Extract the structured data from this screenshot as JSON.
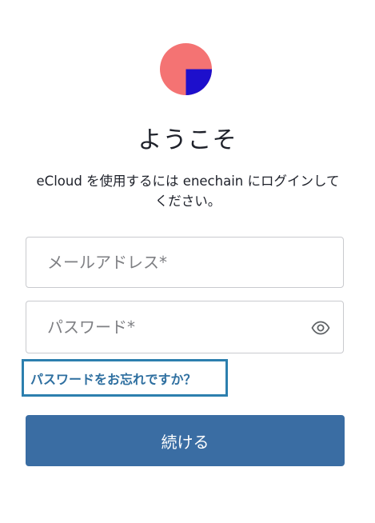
{
  "brand": {
    "logo_icon": "enechain-logo-icon",
    "logo_colors": {
      "circle": "#f47373",
      "quarter": "#1d0fcc"
    }
  },
  "header": {
    "title": "ようこそ",
    "subtitle": "eCloud を使用するには enechain にログインしてください。"
  },
  "form": {
    "email_placeholder": "メールアドレス*",
    "email_value": "",
    "password_placeholder": "パスワード*",
    "password_value": "",
    "password_toggle_icon": "eye-icon",
    "forgot_password_label": "パスワードをお忘れですか？",
    "continue_label": "続ける"
  },
  "colors": {
    "primary_button": "#3a6da3",
    "link": "#2e6fa0",
    "focus_ring": "#2c7fae",
    "border": "#c9cace"
  }
}
